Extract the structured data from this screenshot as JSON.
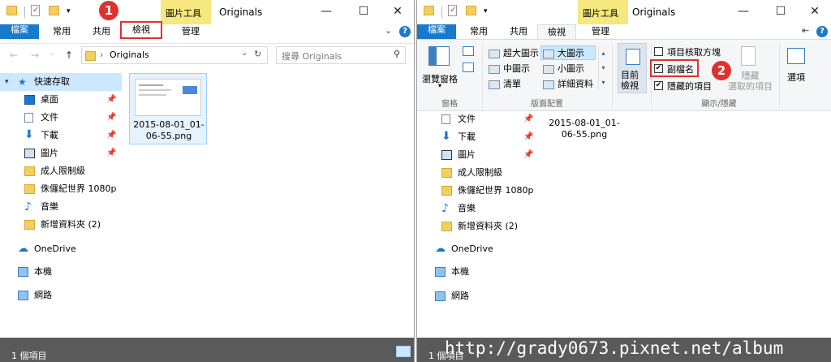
{
  "left": {
    "context_tab": "圖片工具",
    "title": "Originals",
    "tabs": {
      "file": "檔案",
      "home": "常用",
      "share": "共用",
      "view": "檢視",
      "manage": "管理"
    },
    "address": {
      "path": "Originals",
      "search_placeholder": "搜尋 Originals"
    },
    "status": "1 個項目",
    "badge": "1"
  },
  "right": {
    "context_tab": "圖片工具",
    "title": "Originals",
    "tabs": {
      "file": "檔案",
      "home": "常用",
      "share": "共用",
      "view": "檢視",
      "manage": "管理"
    },
    "badge": "2",
    "ribbon": {
      "pane_label": "瀏覽窗格",
      "panes_group": "窗格",
      "layouts": [
        "超大圖示",
        "大圖示",
        "中圖示",
        "小圖示",
        "清單",
        "詳細資料"
      ],
      "layout_group": "版面配置",
      "current_view": "目前\n檢視",
      "item_checkboxes": "項目核取方塊",
      "file_ext": "副檔名",
      "hidden_items": "隱藏的項目",
      "hide_selected": "隱藏\n選取的項目",
      "show_group": "顯示/隱藏",
      "options": "選項"
    },
    "status": "1 個項目"
  },
  "nav": {
    "quick_access": "快速存取",
    "items": [
      {
        "label": "桌面",
        "icon": "desktop-icon"
      },
      {
        "label": "文件",
        "icon": "documents-icon"
      },
      {
        "label": "下載",
        "icon": "download-icon"
      },
      {
        "label": "圖片",
        "icon": "pictures-icon"
      },
      {
        "label": "成人限制級",
        "icon": "folder-icon"
      },
      {
        "label": "侏儸紀世界 1080p",
        "icon": "folder-icon"
      },
      {
        "label": "音樂",
        "icon": "music-icon"
      },
      {
        "label": "新增資料夾 (2)",
        "icon": "folder-icon"
      }
    ],
    "onedrive": "OneDrive",
    "this_pc": "本機",
    "network": "網路"
  },
  "file": {
    "name_line1": "2015-08-01_01-",
    "name_line2": "06-55.png"
  },
  "watermark": "http://grady0673.pixnet.net/album"
}
